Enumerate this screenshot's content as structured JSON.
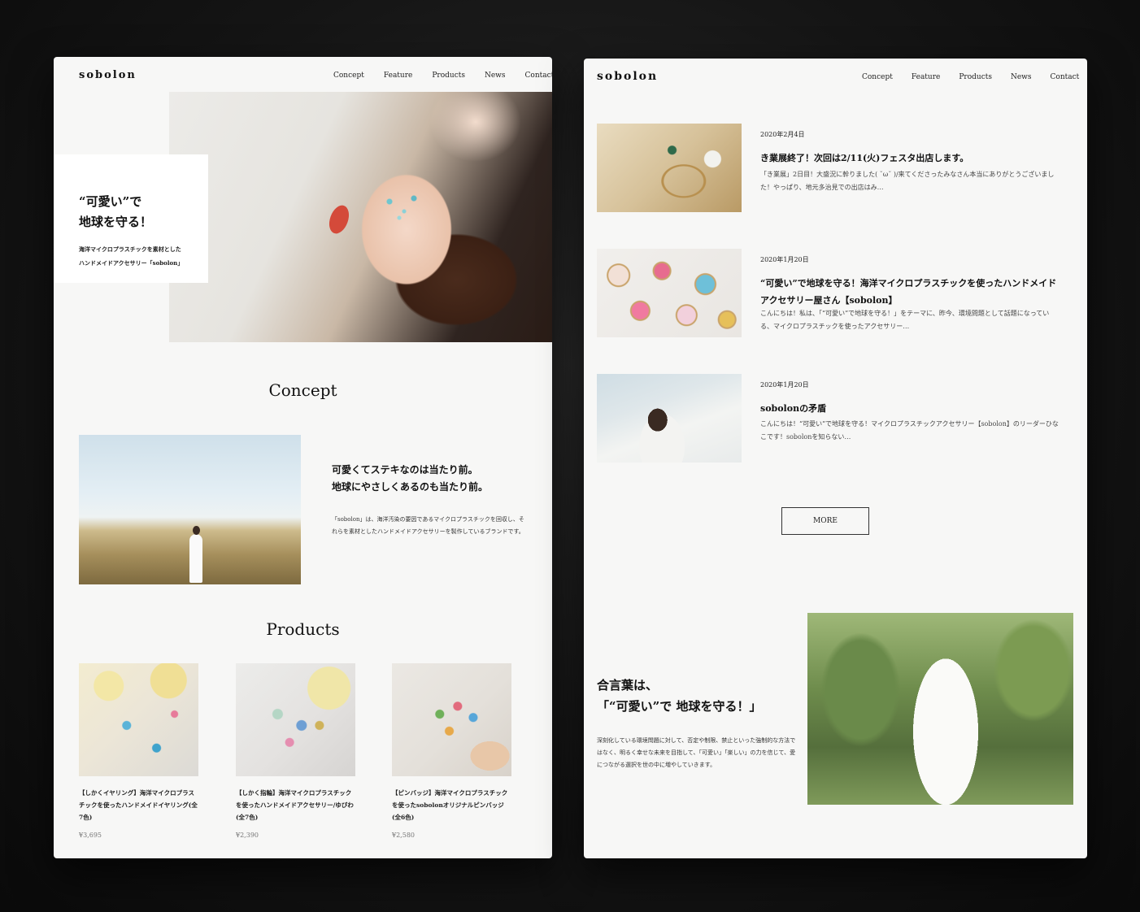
{
  "left": {
    "logo": "sobolon",
    "nav": [
      "Concept",
      "Feature",
      "Products",
      "News",
      "Contact"
    ],
    "hero": {
      "title_line1": "“可愛い”で",
      "title_line2": "地球を守る！",
      "sub_line1": "海洋マイクロプラスチックを素材とした",
      "sub_line2": "ハンドメイドアクセサリー「sobolon」"
    },
    "concept": {
      "heading": "Concept",
      "title_line1": "可愛くてステキなのは当たり前。",
      "title_line2": "地球にやさしくあるのも当たり前。",
      "text": "「sobolon」は、海洋汚染の要因であるマイクロプラスチックを回収し、それらを素材としたハンドメイドアクセサリーを製作しているブランドです。"
    },
    "products": {
      "heading": "Products",
      "items": [
        {
          "name": "【しかくイヤリング】海洋マイクロプラスチックを使ったハンドメイドイヤリング(全7色)",
          "price": "¥3,695"
        },
        {
          "name": "【しかく指輪】海洋マイクロプラスチックを使ったハンドメイドアクセサリー/ゆびわ(全7色)",
          "price": "¥2,390"
        },
        {
          "name": "【ピンバッジ】海洋マイクロプラスチックを使ったsobolonオリジナルピンバッジ(全6色)",
          "price": "¥2,580"
        }
      ]
    }
  },
  "right": {
    "logo": "sobolon",
    "nav": [
      "Concept",
      "Feature",
      "Products",
      "News",
      "Contact"
    ],
    "news": [
      {
        "date": "2020年2月4日",
        "title": "き業展終了！次回は2/11(火)フェスタ出店します。",
        "excerpt": "「き業展」2日目！大盛況に幹りました( ˘ω˘ )/来てくださったみなさん本当にありがとうございました！やっぱり、地元多治見での出店はみ…"
      },
      {
        "date": "2020年1月20日",
        "title": "“可愛い”で地球を守る！海洋マイクロプラスチックを使ったハンドメイドアクセサリー屋さん【sobolon】",
        "excerpt": "こんにちは！私は、「“可愛い”で地球を守る！」をテーマに、昨今、環境問題として話題になっている、マイクロプラスチックを使ったアクセサリー…"
      },
      {
        "date": "2020年1月20日",
        "title": "sobolonの矛盾",
        "excerpt": "こんにちは！“可愛い”で地球を守る！マイクロプラスチックアクセサリー【sobolon】のリーダーひなこです！sobolonを知らない…"
      }
    ],
    "more_label": "MORE",
    "motto": {
      "title_line1": "合言葉は、",
      "title_line2": "「“可愛い”で 地球を守る！」",
      "text": "深刻化している環境問題に対して、否定や制限、禁止といった強制的な方法ではなく、明るく幸せな未来を目指して、「可愛い」「楽しい」の力を信じて、愛につながる選択を世の中に増やしていきます。"
    }
  }
}
